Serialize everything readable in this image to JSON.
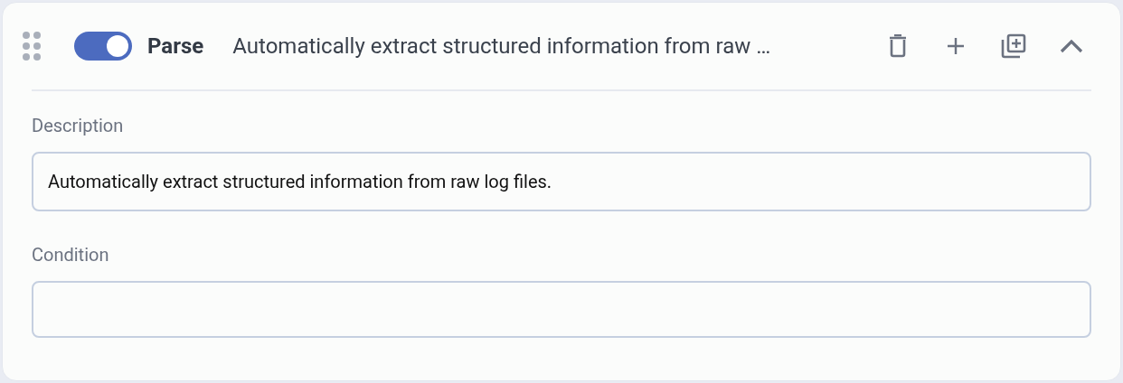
{
  "step": {
    "enabled": true,
    "name": "Parse",
    "summary": "Automatically extract structured information from raw …",
    "expanded": true
  },
  "fields": [
    {
      "label": "Description",
      "value": "Automatically extract structured information from raw log files."
    },
    {
      "label": "Condition"
    }
  ]
}
